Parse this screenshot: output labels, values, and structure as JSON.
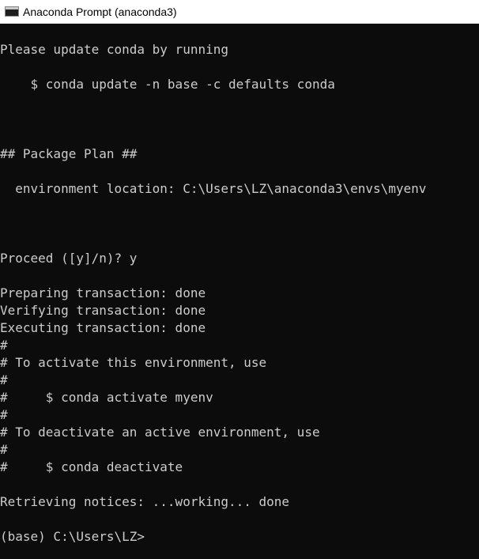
{
  "window": {
    "title": "Anaconda Prompt (anaconda3)",
    "icon": "console-window-icon"
  },
  "console": {
    "lines": [
      "Please update conda by running",
      "    $ conda update -n base -c defaults conda",
      "## Package Plan ##",
      "  environment location: C:\\Users\\LZ\\anaconda3\\envs\\myenv",
      "Proceed ([y]/n)? y",
      "Preparing transaction: done",
      "Verifying transaction: done",
      "Executing transaction: done",
      "#",
      "# To activate this environment, use",
      "#",
      "#     $ conda activate myenv",
      "#",
      "# To deactivate an active environment, use",
      "#",
      "#     $ conda deactivate",
      "Retrieving notices: ...working... done",
      "(base) C:\\Users\\LZ>"
    ]
  }
}
